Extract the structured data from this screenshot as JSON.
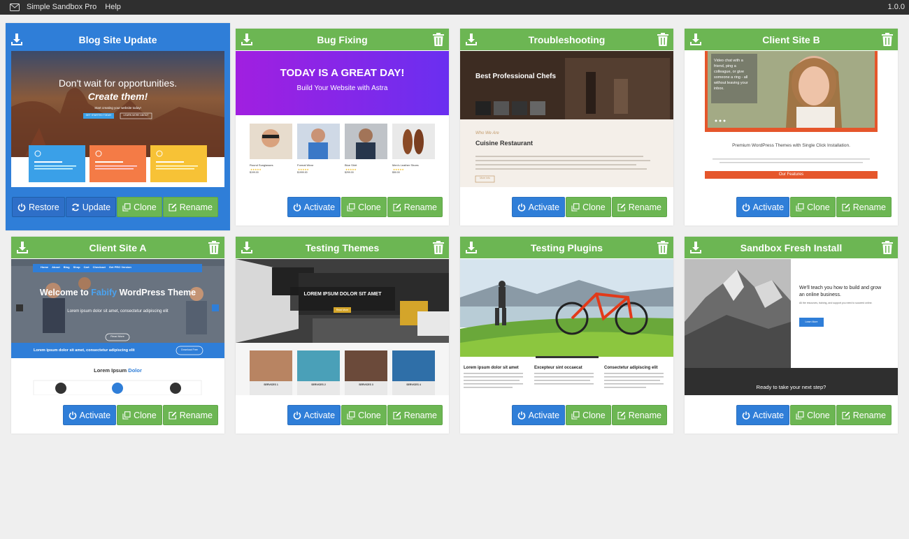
{
  "app": {
    "name": "Simple Sandbox Pro",
    "menu": [
      "Help"
    ],
    "version": "1.0.0"
  },
  "colors": {
    "header_green": "#6cb653",
    "active_blue": "#2f7ed8",
    "button_blue": "#2f7ed8",
    "button_green": "#6cb653",
    "menubar": "#2f2f2f",
    "background": "#efefef"
  },
  "buttons": {
    "restore": "Restore",
    "update": "Update",
    "activate": "Activate",
    "clone": "Clone",
    "rename": "Rename"
  },
  "sandboxes": [
    {
      "title": "Blog Site Update",
      "active": true,
      "preview": {
        "headline": "Don't wait for opportunities.",
        "headline2": "Create them!",
        "sub": "Start creating your website today!",
        "cta1": "GET STARTED TODAY",
        "cta2": "LEARN MORE ABOUT"
      }
    },
    {
      "title": "Bug Fixing",
      "active": false,
      "preview": {
        "headline": "TODAY IS A GREAT DAY!",
        "sub": "Build Your Website with Astra",
        "products": [
          "Round Sunglasses",
          "Formal Wear",
          "Blue Shirt",
          "Men's Leather Shoes"
        ],
        "prices": [
          "$199.00",
          "$1999.00",
          "$299.00",
          "$50.00"
        ]
      }
    },
    {
      "title": "Troubleshooting",
      "active": false,
      "preview": {
        "headline": "Best Professional Chefs",
        "tagline": "Who We Are",
        "heading": "Cuisine Restaurant",
        "button": "More info"
      }
    },
    {
      "title": "Client Site B",
      "active": false,
      "preview": {
        "quote": "Video chat with a friend, ping a colleague, or give someone a ring - all without leaving your inbox.",
        "headline": "Premium WordPress Themes with Single Click Installation.",
        "button": "Our Features"
      }
    },
    {
      "title": "Client Site A",
      "active": false,
      "preview": {
        "nav": [
          "Home",
          "About",
          "Blog",
          "Shop",
          "Cart",
          "Checkout",
          "Get PRO Version"
        ],
        "headline_a": "Welcome to",
        "headline_brand": "Fabify",
        "headline_b": "WordPress Theme",
        "sub": "Lorem ipsum dolor sit amet, consectetur adipiscing elit",
        "cta": "Read More",
        "banner": "Lorem ipsum dolor sit amet, consectetur adipiscing elit",
        "banner_btn": "Download Free",
        "section_a": "Lorem Ipsum",
        "section_b": "Dolor"
      }
    },
    {
      "title": "Testing Themes",
      "active": false,
      "preview": {
        "headline": "LOREM IPSUM DOLOR SIT AMET",
        "button": "Read More",
        "services": [
          "SERVICES 1",
          "SERVICES 2",
          "SERVICES 3",
          "SERVICES 4"
        ]
      }
    },
    {
      "title": "Testing Plugins",
      "active": false,
      "preview": {
        "cols": [
          "Lorem ipsum dolor sit amet",
          "Excepteur sint occaecat",
          "Consectetur adipiscing elit"
        ]
      }
    },
    {
      "title": "Sandbox Fresh Install",
      "active": false,
      "preview": {
        "headline": "We'll teach you how to build and grow an online business.",
        "sub": "All the resources, training, and support you need to succeed online.",
        "button": "Learn More",
        "footer": "Ready to take your next step?"
      }
    }
  ]
}
